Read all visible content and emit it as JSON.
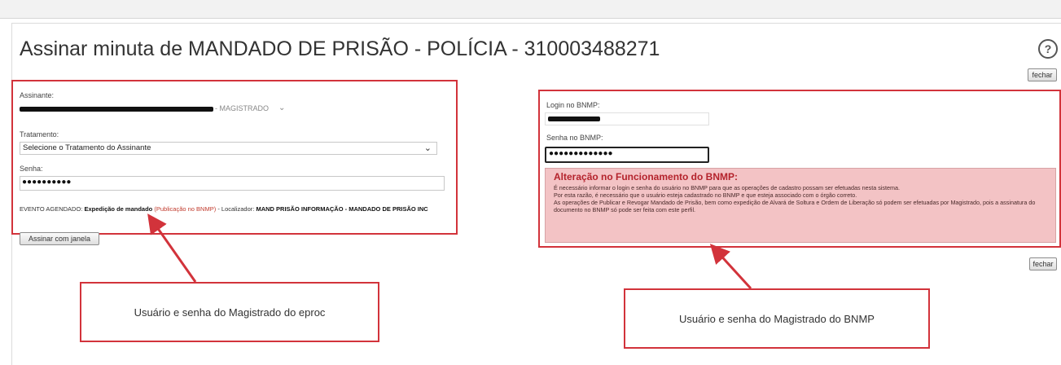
{
  "page_title": "Assinar minuta de MANDADO DE PRISÃO - POLÍCIA - 310003488271",
  "buttons": {
    "fechar_top": "fechar",
    "fechar_bottom": "fechar",
    "assinar": "Assinar com janela"
  },
  "left_form": {
    "assinante_label": "Assinante:",
    "assinante_role": "- MAGISTRADO",
    "tratamento_label": "Tratamento:",
    "tratamento_value": "Selecione o Tratamento do Assinante",
    "senha_label": "Senha:",
    "senha_value": "●●●●●●●●●●",
    "evento_prefix": "EVENTO AGENDADO:",
    "evento_bold1": "Expedição de mandado",
    "evento_red": "(Publicação no BNMP)",
    "evento_mid": "- Localizador:",
    "evento_bold2": "MAND PRISÃO INFORMAÇÃO - MANDADO DE PRISÃO INC"
  },
  "right_form": {
    "login_label": "Login no BNMP:",
    "senha_label": "Senha no BNMP:",
    "senha_value": "●●●●●●●●●●●●●"
  },
  "alert": {
    "title": "Alteração no Funcionamento do BNMP:",
    "lines": [
      "É necessário informar o login e senha do usuário no BNMP para que as operações de cadastro possam ser efetuadas nesta sistema.",
      "Por esta razão, é necessário que o usuário esteja cadastrado no BNMP e que esteja associado com o órgão correto.",
      "As operações de Publicar e Revogar Mandado de Prisão, bem como expedição de Alvará de Soltura e Ordem de Liberação só podem ser efetuadas por Magistrado, pois a assinatura do documento no BNMP só pode ser feita com este perfil."
    ]
  },
  "callouts": {
    "left": "Usuário e senha do Magistrado do eproc",
    "right": "Usuário e senha do Magistrado do BNMP"
  },
  "colors": {
    "annotation_red": "#d2333b",
    "alert_bg": "#f3c3c5",
    "alert_title": "#b4232c"
  },
  "icons": {
    "help": "help-circle-icon",
    "chevron": "chevron-down-icon"
  }
}
